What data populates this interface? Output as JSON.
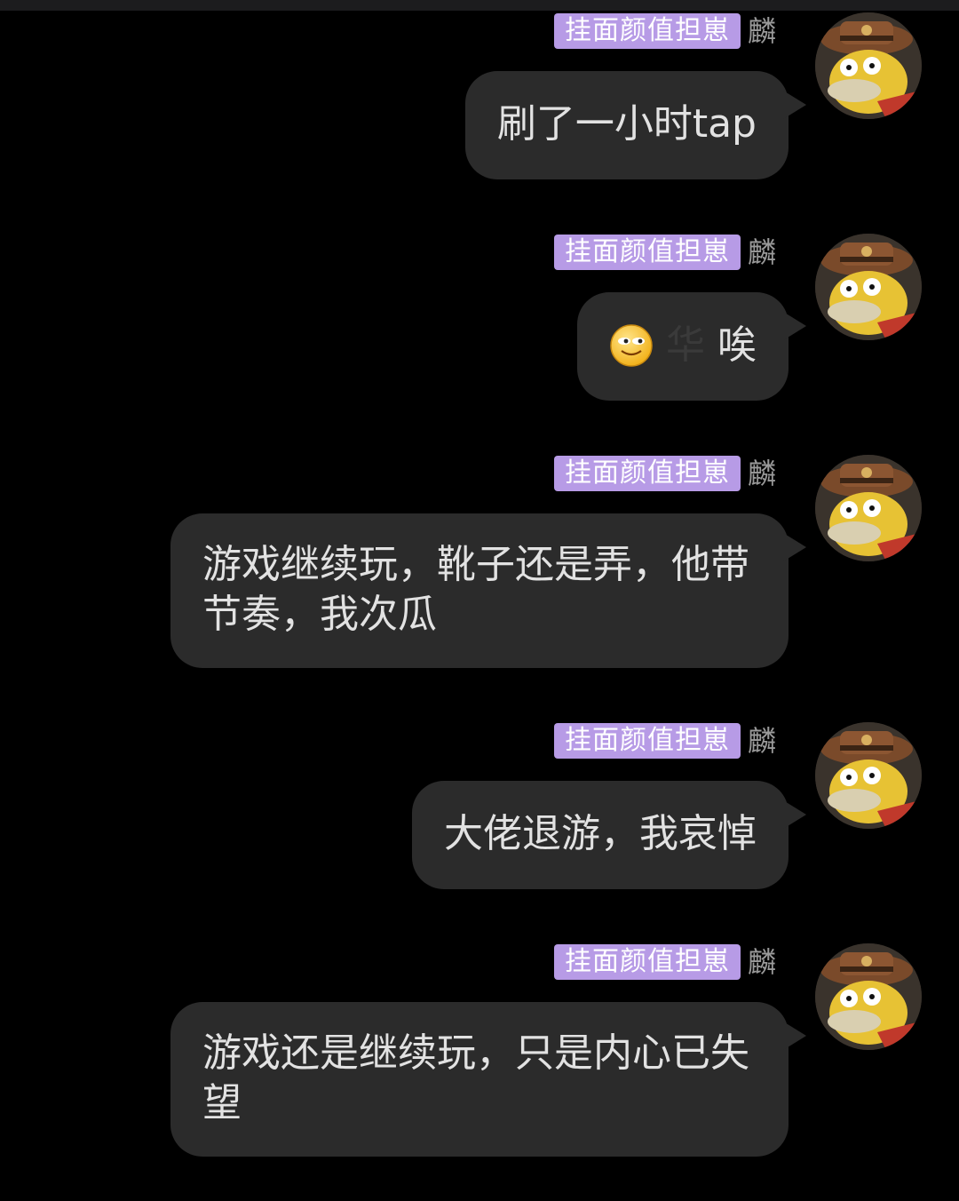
{
  "header": {},
  "colors": {
    "background": "#000000",
    "bubble": "#2b2b2b",
    "bubble_text": "#e2e2e2",
    "tag_bg": "#b79be6",
    "tag_text": "#ffffff",
    "sender_text": "#9a9a9a"
  },
  "messages": [
    {
      "tag": "挂面颜值担崽",
      "sender": "麟",
      "avatar_icon": "psyduck-cowboy-avatar-icon",
      "text": "刷了一小时tap"
    },
    {
      "tag": "挂面颜值担崽",
      "sender": "麟",
      "avatar_icon": "psyduck-cowboy-avatar-icon",
      "emoji_icon": "smirk-face-emoji-icon",
      "faint_text": "华",
      "text": "唉"
    },
    {
      "tag": "挂面颜值担崽",
      "sender": "麟",
      "avatar_icon": "psyduck-cowboy-avatar-icon",
      "text": "游戏继续玩，靴子还是弄，他带节奏，我次瓜"
    },
    {
      "tag": "挂面颜值担崽",
      "sender": "麟",
      "avatar_icon": "psyduck-cowboy-avatar-icon",
      "text": "大佬退游，我哀悼"
    },
    {
      "tag": "挂面颜值担崽",
      "sender": "麟",
      "avatar_icon": "psyduck-cowboy-avatar-icon",
      "text": "游戏还是继续玩，只是内心已失望"
    }
  ]
}
